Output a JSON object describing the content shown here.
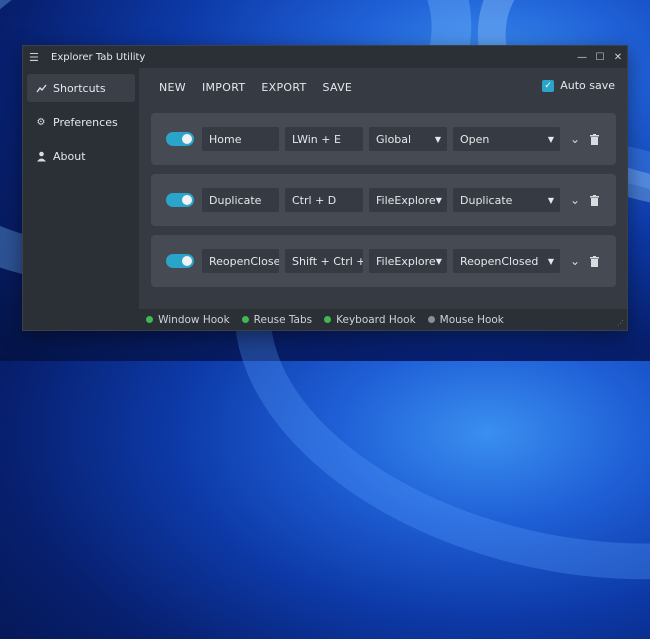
{
  "window": {
    "title": "Explorer Tab Utility"
  },
  "sidebar": {
    "items": [
      {
        "label": "Shortcuts",
        "icon": "shortcuts-icon",
        "active": true
      },
      {
        "label": "Preferences",
        "icon": "gear-icon",
        "active": false
      },
      {
        "label": "About",
        "icon": "person-icon",
        "active": false
      }
    ]
  },
  "toolbar": {
    "new": "NEW",
    "import": "IMPORT",
    "export": "EXPORT",
    "save": "SAVE",
    "autosave_label": "Auto save",
    "autosave_checked": true
  },
  "rows": [
    {
      "enabled": true,
      "name": "Home",
      "keys": "LWin + E",
      "scope": "Global",
      "action": "Open"
    },
    {
      "enabled": true,
      "name": "Duplicate",
      "keys": "Ctrl + D",
      "scope": "FileExplore",
      "action": "Duplicate"
    },
    {
      "enabled": true,
      "name": "ReopenClose",
      "keys": "Shift + Ctrl +",
      "scope": "FileExplore",
      "action": "ReopenClosed"
    }
  ],
  "statusbar": [
    {
      "label": "Window Hook",
      "color": "#3fb950"
    },
    {
      "label": "Reuse Tabs",
      "color": "#3fb950"
    },
    {
      "label": "Keyboard Hook",
      "color": "#3fb950"
    },
    {
      "label": "Mouse Hook",
      "color": "#8a8f96"
    }
  ],
  "colors": {
    "accent": "#2aa4c8",
    "active_status": "#3fb950",
    "inactive_status": "#8a8f96"
  }
}
